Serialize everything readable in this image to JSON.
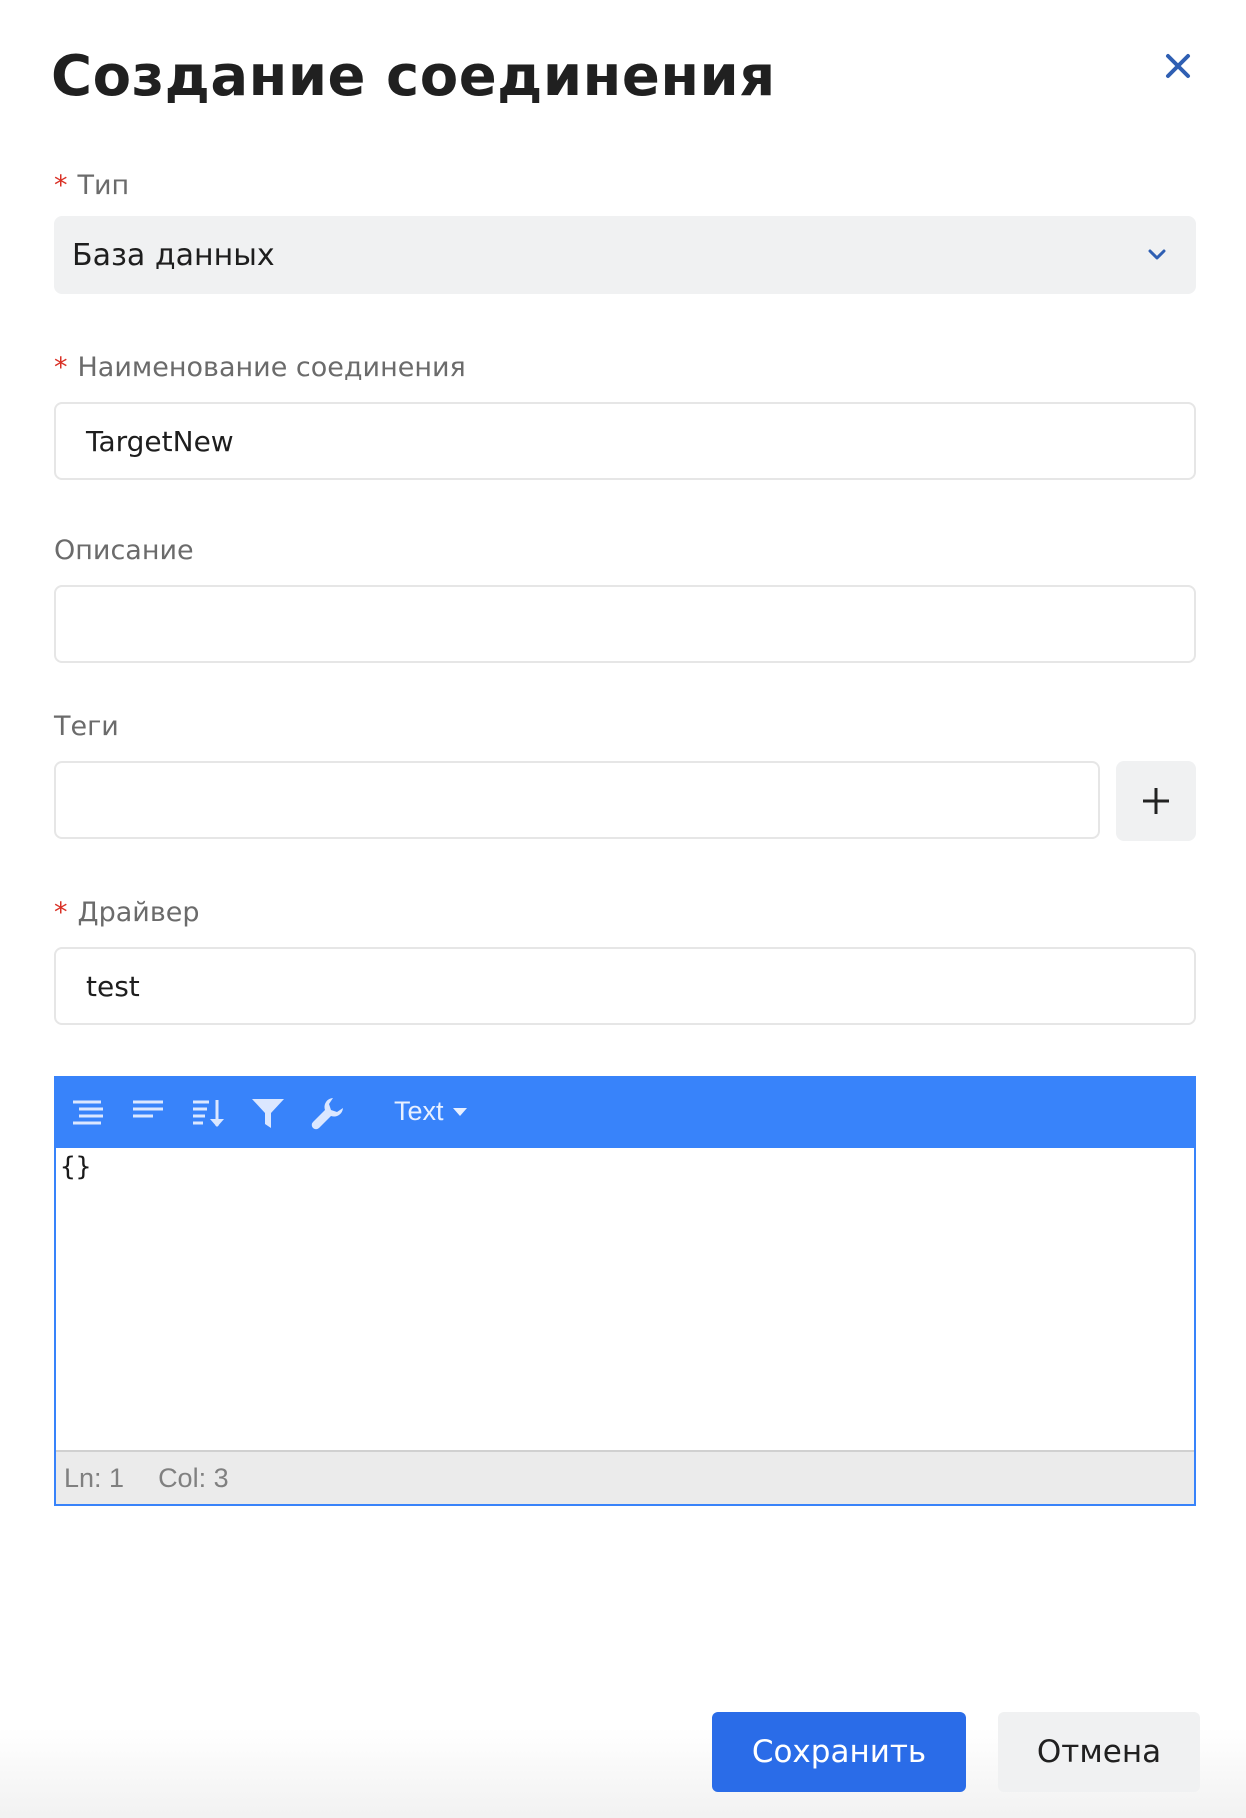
{
  "dialog": {
    "title": "Создание соединения",
    "close_icon": "close-icon"
  },
  "required_mark": "*",
  "fields": {
    "type": {
      "label": "Тип",
      "required": true,
      "value": "База данных",
      "icon": "chevron-down-icon"
    },
    "name": {
      "label": "Наименование соединения",
      "required": true,
      "value": "TargetNew"
    },
    "description": {
      "label": "Описание",
      "required": false,
      "value": ""
    },
    "tags": {
      "label": "Теги",
      "required": false,
      "value": "",
      "add_icon": "plus-icon"
    },
    "driver": {
      "label": "Драйвер",
      "required": true,
      "value": "test"
    }
  },
  "editor": {
    "toolbar": {
      "icons": [
        "format-icon",
        "compact-icon",
        "sort-icon",
        "filter-icon",
        "wrench-icon"
      ],
      "mode_label": "Text"
    },
    "content": "{}",
    "status": {
      "line": "Ln: 1",
      "col": "Col: 3"
    }
  },
  "buttons": {
    "save": "Сохранить",
    "cancel": "Отмена"
  },
  "colors": {
    "accent": "#2a6ce8",
    "editor_toolbar": "#3883fa",
    "required": "#d93025",
    "close_icon": "#2f5fb3"
  }
}
